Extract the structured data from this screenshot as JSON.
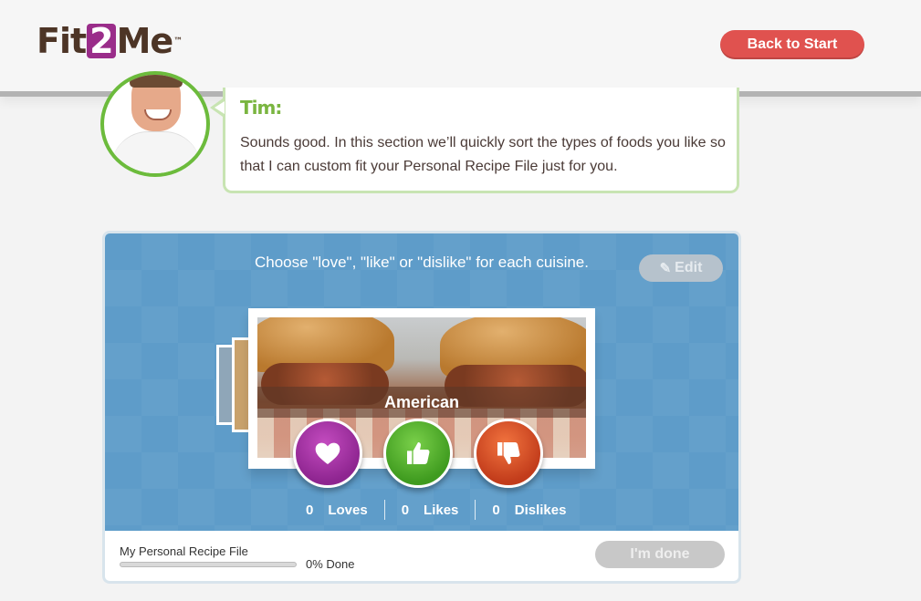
{
  "header": {
    "logo": {
      "part1": "Fit",
      "part2": "2",
      "part3": "Me",
      "trademark": "™"
    },
    "back_button": "Back to Start"
  },
  "coach": {
    "name": "Tim:",
    "message": "Sounds good. In this section we’ll quickly sort the types of foods you like so that I can custom fit your Personal Recipe File just for you."
  },
  "panel": {
    "instruction": "Choose \"love\", \"like\" or \"dislike\" for each cuisine.",
    "edit_button": "Edit",
    "current_cuisine": "American",
    "counts": {
      "loves": {
        "value": "0",
        "label": "Loves"
      },
      "likes": {
        "value": "0",
        "label": "Likes"
      },
      "dislikes": {
        "value": "0",
        "label": "Dislikes"
      }
    },
    "progress": {
      "label": "My Personal Recipe File",
      "percent": 0,
      "text": "0% Done"
    },
    "done_button": "I'm done"
  },
  "colors": {
    "accent_red": "#e0524f",
    "panel_blue": "#5e9cc9",
    "love": "#a0329f",
    "like": "#52b02b",
    "dislike": "#d9512c",
    "coach_green": "#6cbb3c"
  }
}
